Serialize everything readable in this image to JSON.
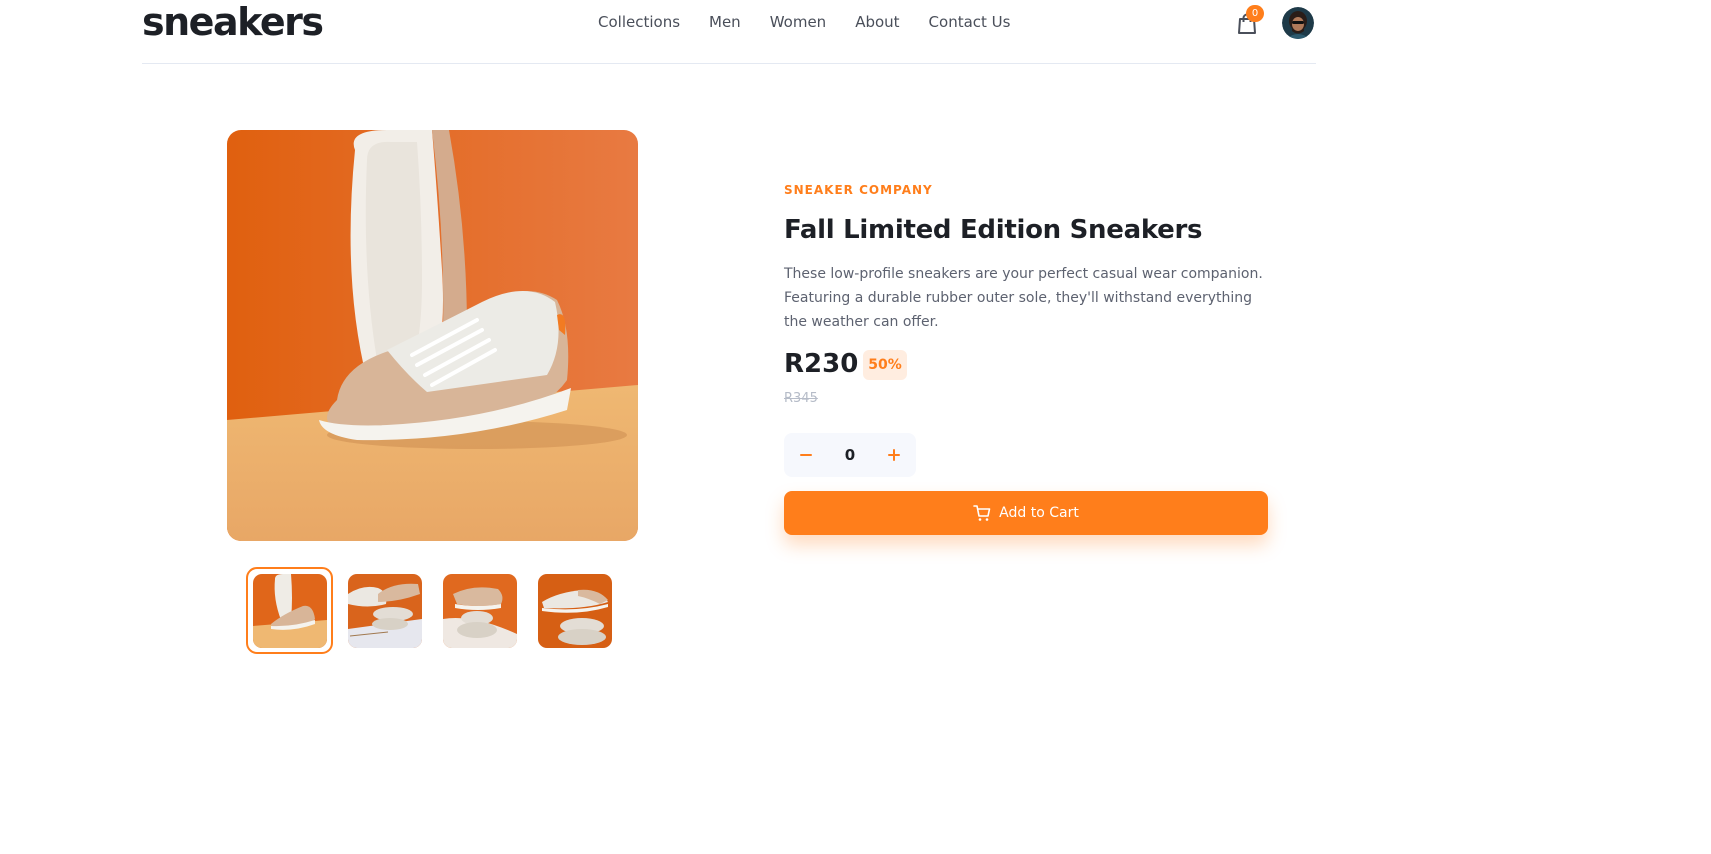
{
  "header": {
    "logo": "sneakers",
    "nav": [
      "Collections",
      "Men",
      "Women",
      "About",
      "Contact Us"
    ],
    "cart_count": "0"
  },
  "product": {
    "company": "SNEAKER COMPANY",
    "title": "Fall Limited Edition Sneakers",
    "description": "These low-profile sneakers are your perfect casual wear companion. Featuring a durable rubber outer sole, they'll withstand everything the weather can offer.",
    "price": "R230",
    "discount": "50%",
    "original_price": "R345",
    "quantity": "0",
    "add_to_cart_label": "Add to Cart",
    "selected_thumbnail": 1,
    "thumbnail_count": 4
  },
  "colors": {
    "accent": "#ff7e1b",
    "accent_pale": "#ffede0",
    "text_dark": "#1d2026",
    "text_muted": "#5d6270"
  }
}
